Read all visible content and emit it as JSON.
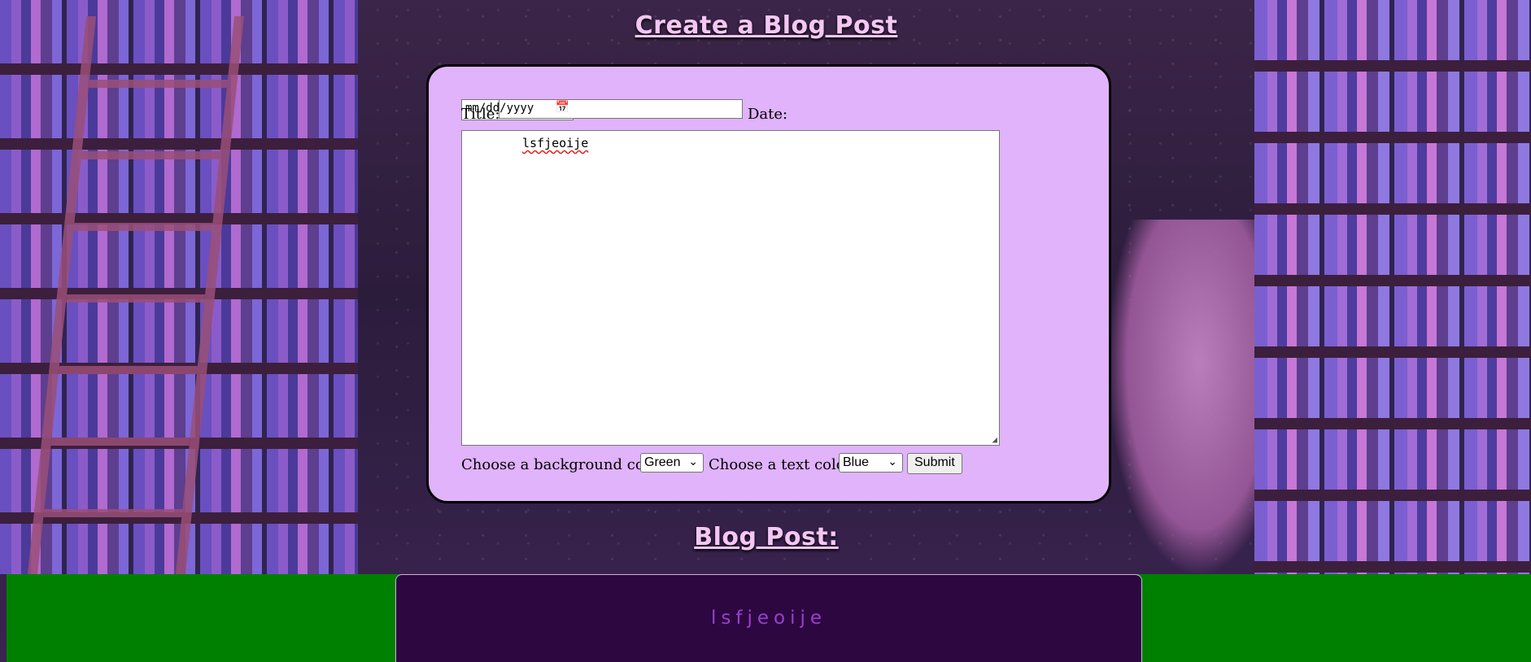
{
  "page": {
    "heading": "Create a Blog Post",
    "post_heading": "Blog Post:"
  },
  "form": {
    "title_label": "Title:",
    "title_value": "",
    "date_label": "Date:",
    "date_placeholder": "mm/dd/yyyy",
    "body_value": "lsfjeoije",
    "bg_color_label": "Choose a background color:",
    "bg_color_selected": "Green",
    "text_color_label": "Choose a text color:",
    "text_color_selected": "Blue",
    "submit_label": "Submit"
  },
  "post": {
    "text": "lsfjeoije",
    "background_color": "#008000",
    "text_color": "#9a3fd0"
  },
  "colors": {
    "card_bg": "#e0b3fb",
    "heading": "#f4c6f4"
  }
}
